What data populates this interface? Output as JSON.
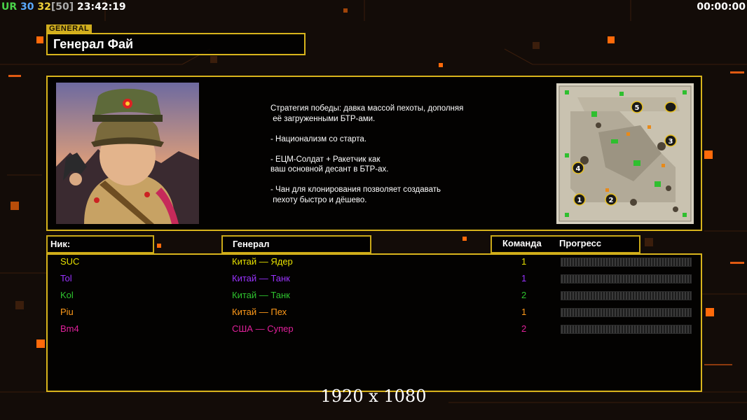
{
  "hud": {
    "left_ur": "UR",
    "left_a": "30",
    "left_b": "32",
    "left_c": "[50]",
    "clock": "23:42:19",
    "timer": "00:00:00"
  },
  "general": {
    "tag": "GENERAL",
    "name": "Генерал Фай",
    "portrait_icon": "general-portrait",
    "description": "Стратегия победы: давка массой пехоты, дополняя\n её загруженными БТР-ами.\n\n- Национализм со старта.\n\n- ЕЦМ-Солдат + Ракетчик как\nваш основной десант в БТР-ах.\n\n- Чан для клонирования позволяет создавать\n пехоту быстро и дёшево."
  },
  "map": {
    "icon": "minimap",
    "start_markers": [
      "1",
      "2",
      "3",
      "4",
      "5"
    ]
  },
  "table": {
    "headers": {
      "nick": "Ник:",
      "general": "Генерал",
      "team": "Команда",
      "progress": "Прогресс"
    },
    "players": [
      {
        "nick": "SUC",
        "general": "Китай — Ядер",
        "team": "1",
        "color": "#e6e000"
      },
      {
        "nick": "Tol",
        "general": "Китай — Танк",
        "team": "1",
        "color": "#9a33ff"
      },
      {
        "nick": "Kol",
        "general": "Китай — Танк",
        "team": "2",
        "color": "#2ec32e"
      },
      {
        "nick": "Piu",
        "general": "Китай — Пех",
        "team": "1",
        "color": "#ff9a1a"
      },
      {
        "nick": "Bm4",
        "general": "США — Супер",
        "team": "2",
        "color": "#e0209a"
      }
    ]
  },
  "colors": {
    "frame": "#d8b41c",
    "accent_orange": "#ff7a10"
  },
  "resolution": "1920 x 1080"
}
